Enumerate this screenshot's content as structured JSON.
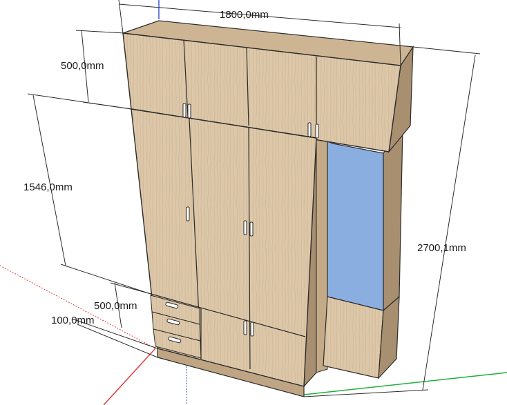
{
  "dimensions": {
    "width": "1800,0mm",
    "top_height": "500,0mm",
    "door_height": "1546,0mm",
    "drawer_height": "500,0mm",
    "plinth": "100,0mm",
    "total_height": "2700,1mm"
  },
  "colors": {
    "wood": "#dcc7a8",
    "wood_dark": "#bfa583",
    "wood_side": "#a88f70",
    "mirror": "#8aaee0",
    "edge": "#2b2b2b",
    "axis_red": "#e23b3b",
    "axis_green": "#1fae3a",
    "axis_blue": "#3c57d8"
  }
}
